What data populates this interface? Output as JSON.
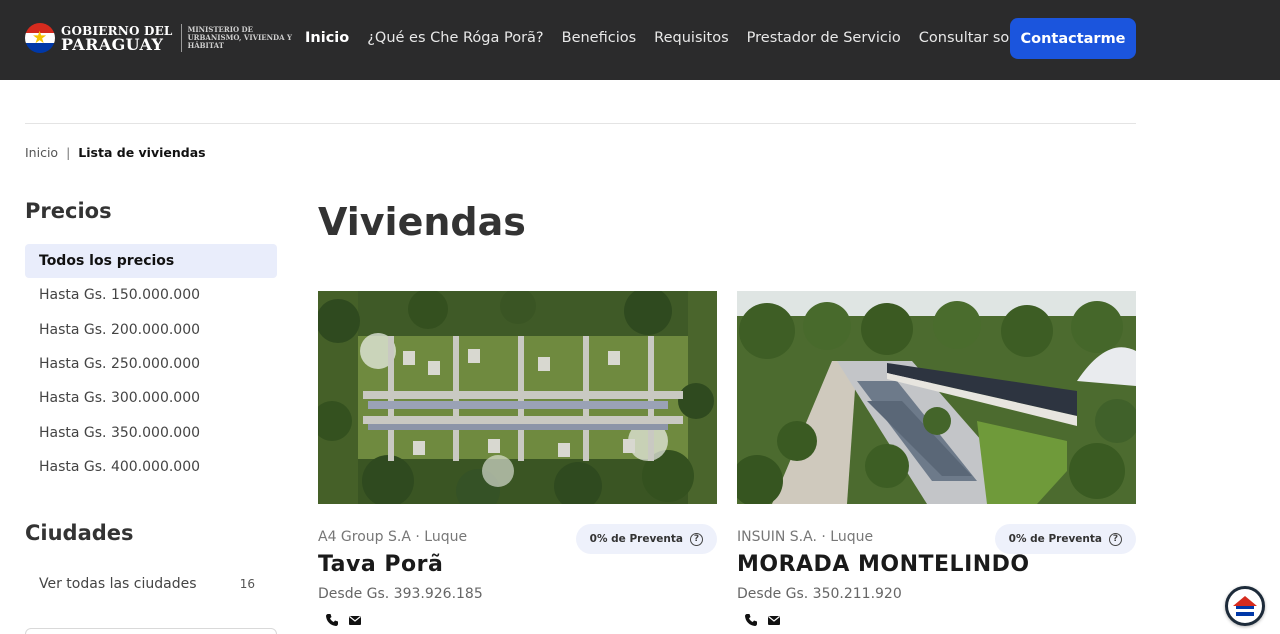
{
  "header": {
    "logo": {
      "line1": "GOBIERNO DEL",
      "line2": "PARAGUAY",
      "ministry": "MINISTERIO DE URBANISMO, VIVIENDA Y HÁBITAT"
    },
    "nav": [
      {
        "label": "Inicio",
        "active": true
      },
      {
        "label": "¿Qué es Che Róga Porã?"
      },
      {
        "label": "Beneficios"
      },
      {
        "label": "Requisitos"
      },
      {
        "label": "Prestador de Servicio"
      },
      {
        "label": "Consultar solicitud"
      }
    ],
    "cta_label": "Contactarme",
    "cta_color": "#1b55dd",
    "bar_color": "#2b2b2c"
  },
  "breadcrumb": {
    "home": "Inicio",
    "separator": "|",
    "current": "Lista de viviendas"
  },
  "sidebar": {
    "prices_title": "Precios",
    "prices": [
      "Todos los precios",
      "Hasta Gs. 150.000.000",
      "Hasta Gs. 200.000.000",
      "Hasta Gs. 250.000.000",
      "Hasta Gs. 300.000.000",
      "Hasta Gs. 350.000.000",
      "Hasta Gs. 400.000.000"
    ],
    "cities_title": "Ciudades",
    "cities_all_label": "Ver todas las ciudades",
    "cities_count": "16"
  },
  "main": {
    "title": "Viviendas",
    "cards": [
      {
        "developer": "A4 Group S.A",
        "city": "Luque",
        "badge": "0% de Preventa",
        "name": "Tava Porã",
        "price": "Desde Gs. 393.926.185",
        "image": "aerial-housing-plan"
      },
      {
        "developer": "INSUIN S.A.",
        "city": "Luque",
        "badge": "0% de Preventa",
        "name": "MORADA MONTELINDO",
        "price": "Desde Gs. 350.211.920",
        "image": "housing-render-perspective"
      }
    ]
  }
}
